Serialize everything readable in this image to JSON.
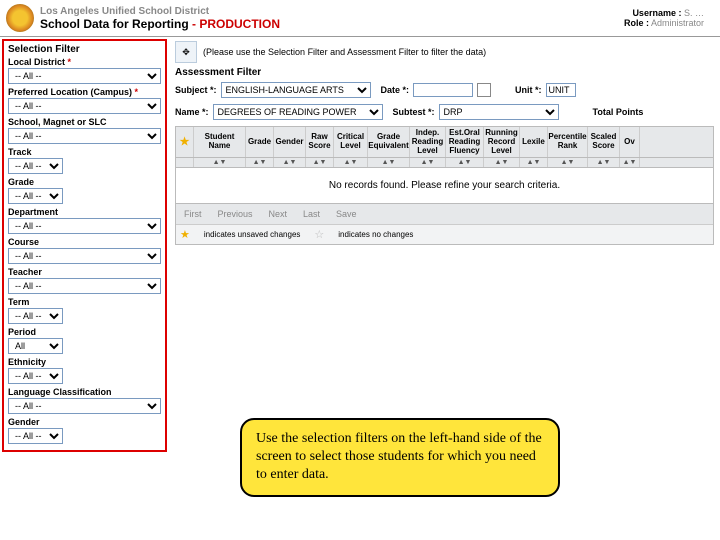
{
  "header": {
    "district": "Los Angeles Unified School District",
    "app": "School Data for Reporting",
    "env": " - PRODUCTION",
    "username_lbl": "Username :",
    "username_val": "S. …",
    "role_lbl": "Role :",
    "role_val": "Administrator"
  },
  "sidebar": {
    "title": "Selection Filter",
    "fields": [
      {
        "label": "Local District",
        "req": true,
        "value": "-- All --",
        "narrow": false
      },
      {
        "label": "Preferred Location (Campus)",
        "req": true,
        "value": "-- All --",
        "narrow": false
      },
      {
        "label": "School, Magnet or SLC",
        "req": false,
        "value": "-- All --",
        "narrow": false
      },
      {
        "label": "Track",
        "req": false,
        "value": "-- All --",
        "narrow": true
      },
      {
        "label": "Grade",
        "req": false,
        "value": "-- All --",
        "narrow": true
      },
      {
        "label": "Department",
        "req": false,
        "value": "-- All --",
        "narrow": false
      },
      {
        "label": "Course",
        "req": false,
        "value": "-- All --",
        "narrow": false
      },
      {
        "label": "Teacher",
        "req": false,
        "value": "-- All --",
        "narrow": false
      },
      {
        "label": "Term",
        "req": false,
        "value": "-- All --",
        "narrow": true
      },
      {
        "label": "Period",
        "req": false,
        "value": "All",
        "narrow": true
      },
      {
        "label": "Ethnicity",
        "req": false,
        "value": "-- All --",
        "narrow": true
      },
      {
        "label": "Language Classification",
        "req": false,
        "value": "-- All --",
        "narrow": false
      },
      {
        "label": "Gender",
        "req": false,
        "value": "-- All --",
        "narrow": true
      }
    ]
  },
  "content": {
    "hint": "(Please use the Selection Filter and Assessment Filter to filter the data)",
    "af_title": "Assessment Filter",
    "row1": {
      "subject_lbl": "Subject *:",
      "subject_val": "ENGLISH-LANGUAGE ARTS",
      "date_lbl": "Date *:",
      "date_val": "",
      "unit_lbl": "Unit *:",
      "unit_val": "UNIT"
    },
    "row2": {
      "name_lbl": "Name *:",
      "name_val": "DEGREES OF READING POWER",
      "subtest_lbl": "Subtest *:",
      "subtest_val": "DRP",
      "points_lbl": "Total Points"
    },
    "columns": [
      "Student Name",
      "Grade",
      "Gender",
      "Raw Score",
      "Critical Level",
      "Grade Equivalent",
      "Indep. Reading Level",
      "Est.Oral Reading Fluency",
      "Running Record Level",
      "Lexile",
      "Percentile Rank",
      "Scaled Score",
      "Ov"
    ],
    "no_records": "No records found. Please refine your search criteria.",
    "pager": [
      "First",
      "Previous",
      "Next",
      "Last",
      "Save"
    ],
    "legend_unsaved": "indicates unsaved changes",
    "legend_nochange": "indicates no changes"
  },
  "callout": "Use the selection filters on the left-hand side of the screen to select those students for which you need to enter data."
}
